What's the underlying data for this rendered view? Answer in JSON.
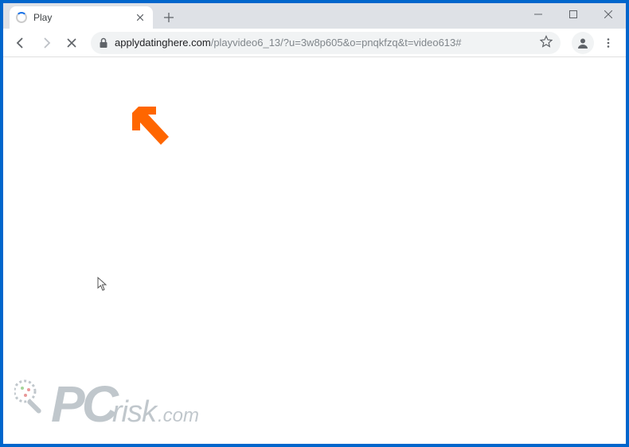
{
  "tab": {
    "title": "Play",
    "loading": true
  },
  "url": {
    "domain": "applydatinghere.com",
    "path": "/playvideo6_13/?u=3w8p605&o=pnqkfzq&t=video613#"
  },
  "watermark": {
    "pc": "PC",
    "risk": "risk",
    "com": ".com"
  },
  "colors": {
    "frame": "#0066cc",
    "tabstrip": "#dee1e6",
    "arrow": "#ff6600"
  }
}
